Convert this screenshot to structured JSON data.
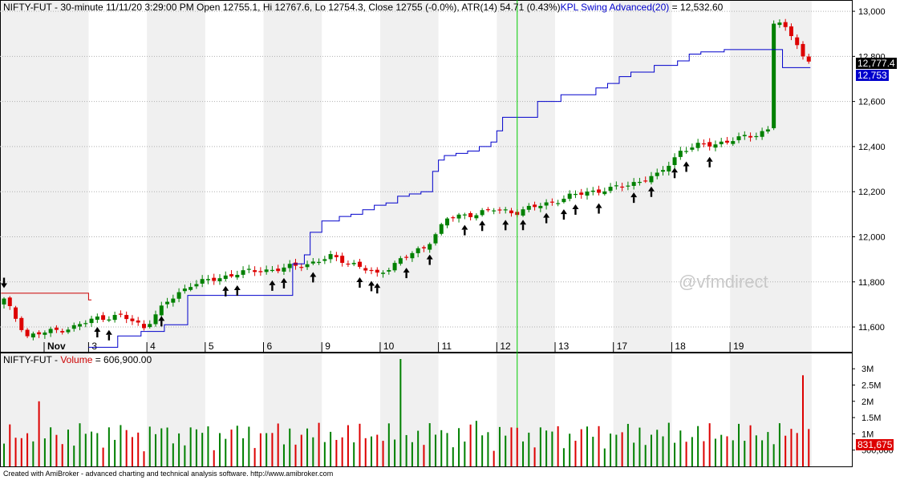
{
  "header": {
    "symbol": "NIFTY-FUT",
    "interval": "30-minute",
    "datetime": "11/11/20 3:29:00 PM",
    "open_label": "Open",
    "open": "12755.1",
    "high_label": "Hi",
    "high": "12767.6",
    "low_label": "Lo",
    "low": "12754.3",
    "close_label": "Close",
    "close": "12755 (-0.0%),",
    "atr_label": "ATR(14)",
    "atr": "54.71  (0.43%)",
    "indicator_label": "KPL Swing Advanced(20)",
    "indicator_value": "= 12,532.60"
  },
  "volume_header": {
    "symbol": "NIFTY-FUT",
    "label": "Volume",
    "value": "= 606,900.00"
  },
  "footer": "Created with AmiBroker - advanced charting and technical analysis software. http://www.amibroker.com",
  "watermark": "@vfmdirect",
  "price_tags": {
    "last_price": "12,777.4",
    "swing_level": "12,753",
    "last_volume": "831,675"
  },
  "colors": {
    "up": "#008000",
    "down": "#dd0000",
    "swing_line": "#0000cc",
    "resistance_line": "#cc0000",
    "cursor_line": "#00cc00",
    "band": "#f0f0f0"
  },
  "chart_data": [
    {
      "type": "candlestick",
      "title": "NIFTY-FUT - 30-minute",
      "y_axis_ticks": [
        "11,600",
        "11,800",
        "12,000",
        "12,200",
        "12,400",
        "12,600",
        "12,800",
        "13,000"
      ],
      "ylim": [
        11490,
        13050
      ],
      "x_axis_labels": [
        "Nov",
        "3",
        "4",
        "5",
        "6",
        "9",
        "10",
        "11",
        "12",
        "13",
        "17",
        "18",
        "19"
      ],
      "grid": true,
      "bar_count": 139,
      "anchors": [
        [
          0,
          11720
        ],
        [
          4,
          11560
        ],
        [
          8,
          11580
        ],
        [
          12,
          11600
        ],
        [
          16,
          11640
        ],
        [
          20,
          11650
        ],
        [
          24,
          11600
        ],
        [
          28,
          11710
        ],
        [
          32,
          11790
        ],
        [
          36,
          11810
        ],
        [
          40,
          11840
        ],
        [
          44,
          11850
        ],
        [
          48,
          11860
        ],
        [
          52,
          11880
        ],
        [
          56,
          11910
        ],
        [
          60,
          11880
        ],
        [
          64,
          11830
        ],
        [
          68,
          11900
        ],
        [
          72,
          11950
        ],
        [
          76,
          12080
        ],
        [
          80,
          12100
        ],
        [
          84,
          12120
        ],
        [
          88,
          12110
        ],
        [
          92,
          12140
        ],
        [
          96,
          12170
        ],
        [
          100,
          12200
        ],
        [
          104,
          12210
        ],
        [
          108,
          12240
        ],
        [
          112,
          12270
        ],
        [
          116,
          12380
        ],
        [
          120,
          12410
        ],
        [
          124,
          12420
        ],
        [
          128,
          12450
        ],
        [
          132,
          12480
        ],
        [
          136,
          12560
        ],
        [
          139,
          12565
        ]
      ],
      "up_arrow_bars": [
        16,
        18,
        27,
        38,
        40,
        46,
        48,
        53,
        61,
        63,
        64,
        69,
        73,
        79,
        82,
        86,
        89,
        93,
        96,
        98,
        102,
        108,
        111,
        115,
        117,
        121
      ],
      "down_arrow_bars": [
        0
      ],
      "series": [
        {
          "name": "KPL Swing Advanced(20)",
          "values_steps": [
            [
              15,
              11510
            ],
            [
              20,
              11560
            ],
            [
              24,
              11580
            ],
            [
              28,
              11610
            ],
            [
              32,
              11740
            ],
            [
              36,
              11740
            ],
            [
              48,
              11740
            ],
            [
              50,
              11880
            ],
            [
              52,
              11920
            ],
            [
              53,
              12020
            ],
            [
              55,
              12070
            ],
            [
              58,
              12090
            ],
            [
              60,
              12100
            ],
            [
              62,
              12120
            ],
            [
              64,
              12140
            ],
            [
              66,
              12150
            ],
            [
              68,
              12180
            ],
            [
              70,
              12190
            ],
            [
              72,
              12200
            ],
            [
              74,
              12290
            ],
            [
              75,
              12340
            ],
            [
              76,
              12360
            ],
            [
              78,
              12370
            ],
            [
              80,
              12380
            ],
            [
              82,
              12400
            ],
            [
              84,
              12420
            ],
            [
              85,
              12470
            ],
            [
              86,
              12530
            ],
            [
              88,
              12530
            ],
            [
              92,
              12600
            ],
            [
              96,
              12630
            ],
            [
              100,
              12630
            ],
            [
              102,
              12660
            ],
            [
              104,
              12680
            ],
            [
              106,
              12710
            ],
            [
              108,
              12730
            ],
            [
              112,
              12760
            ],
            [
              116,
              12780
            ],
            [
              118,
              12810
            ],
            [
              120,
              12820
            ],
            [
              124,
              12830
            ],
            [
              128,
              12830
            ],
            [
              132,
              12830
            ],
            [
              134,
              12750
            ]
          ]
        },
        {
          "name": "resistance",
          "values_steps": [
            [
              0,
              11750
            ],
            [
              14,
              11750
            ],
            [
              15,
              11720
            ]
          ]
        }
      ],
      "cursor_bar": 88
    },
    {
      "type": "bar",
      "title": "NIFTY-FUT - Volume",
      "y_axis_ticks": [
        "500,000",
        "1M",
        "1.5M",
        "2M",
        "2.5M",
        "3M"
      ],
      "ylim": [
        0,
        3300000
      ],
      "highlight_bars": [
        6,
        68,
        81,
        137
      ],
      "highlight_values": [
        2000000,
        3300000,
        1400000,
        2800000
      ]
    }
  ]
}
